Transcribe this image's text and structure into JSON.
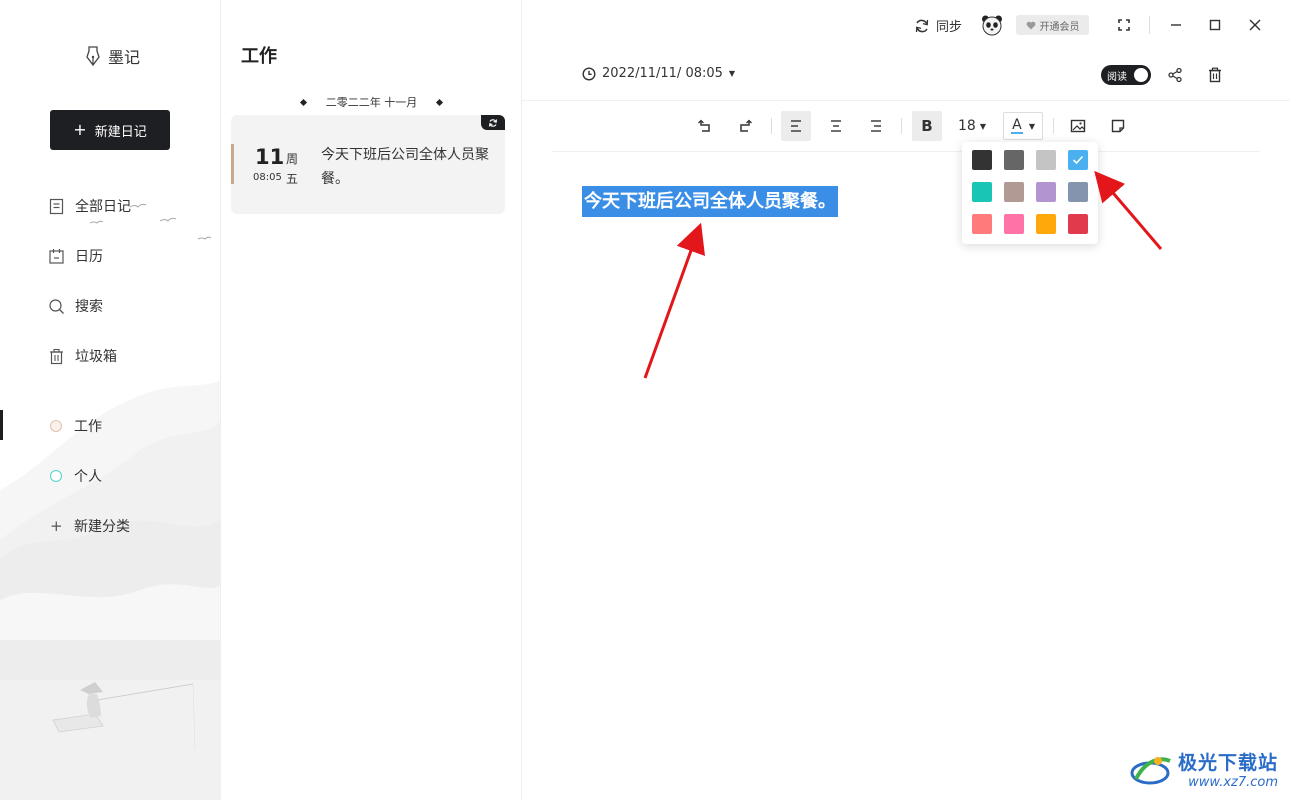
{
  "app": {
    "name": "墨记"
  },
  "sidebar": {
    "new_diary_label": "新建日记",
    "nav": [
      {
        "label": "全部日记",
        "icon": "document-icon"
      },
      {
        "label": "日历",
        "icon": "calendar-icon"
      },
      {
        "label": "搜索",
        "icon": "search-icon"
      },
      {
        "label": "垃圾箱",
        "icon": "trash-icon"
      }
    ],
    "categories": [
      {
        "label": "工作",
        "dot_color": "#e2c2b0",
        "active": true
      },
      {
        "label": "个人",
        "dot_color": "#55d6c4",
        "active": false
      }
    ],
    "new_category_label": "新建分类"
  },
  "list": {
    "title": "工作",
    "month_label": "二零二二年 十一月",
    "entries": [
      {
        "day": "11",
        "weekday": "周五",
        "weekday_1": "周",
        "weekday_2": "五",
        "time": "08:05",
        "text": "今天下班后公司全体人员聚餐。"
      }
    ]
  },
  "topbar": {
    "sync_label": "同步",
    "vip_label": "开通会员"
  },
  "editor": {
    "datetime": "2022/11/11/ 08:05",
    "read_label": "阅读",
    "font_size": "18",
    "font_color_glyph": "A",
    "bold_glyph": "B",
    "content": "今天下班后公司全体人员聚餐。"
  },
  "color_palette": {
    "selected": "#4ab0ef",
    "colors": [
      "#333333",
      "#666666",
      "#c4c4c4",
      "#4ab0ef",
      "#17c6b4",
      "#b29a94",
      "#b294d1",
      "#8594ae",
      "#ff7a7a",
      "#ff72a8",
      "#ffa80c",
      "#e03a4c"
    ]
  },
  "watermark": {
    "title": "极光下载站",
    "url": "www.xz7.com"
  },
  "colors": {
    "accent_dark": "#1e1f22",
    "selection": "#3a8ee6",
    "arrow": "#e3161b"
  }
}
